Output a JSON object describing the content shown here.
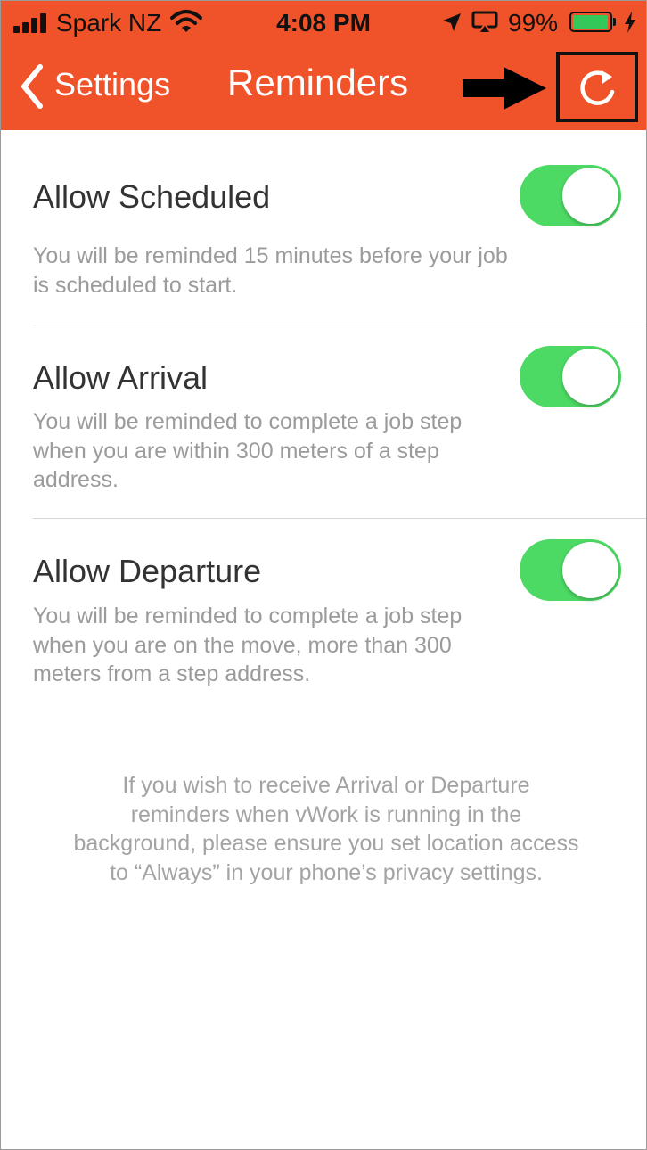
{
  "status_bar": {
    "carrier": "Spark NZ",
    "time": "4:08 PM",
    "battery_percent": "99%",
    "icons": [
      "signal-bars-icon",
      "wifi-icon",
      "location-arrow-icon",
      "airplay-icon",
      "battery-icon",
      "charging-bolt-icon"
    ]
  },
  "nav": {
    "back_label": "Settings",
    "title": "Reminders",
    "refresh_icon": "refresh-icon",
    "accent_color": "#f0522a"
  },
  "settings": [
    {
      "title": "Allow Scheduled",
      "description": "You will be reminded 15 minutes before your job is scheduled to start.",
      "enabled": true
    },
    {
      "title": "Allow Arrival",
      "description": "You will be reminded to complete a job step when you are within 300 meters of a step address.",
      "enabled": true
    },
    {
      "title": "Allow Departure",
      "description": "You will be reminded to complete a job step when you are on the move, more than 300 meters from a step address.",
      "enabled": true
    }
  ],
  "toggle_on_color": "#4cd964",
  "footer_note": "If you wish to receive Arrival or Departure reminders when vWork is running in the background, please ensure you set location access to “Always” in your phone’s privacy settings."
}
